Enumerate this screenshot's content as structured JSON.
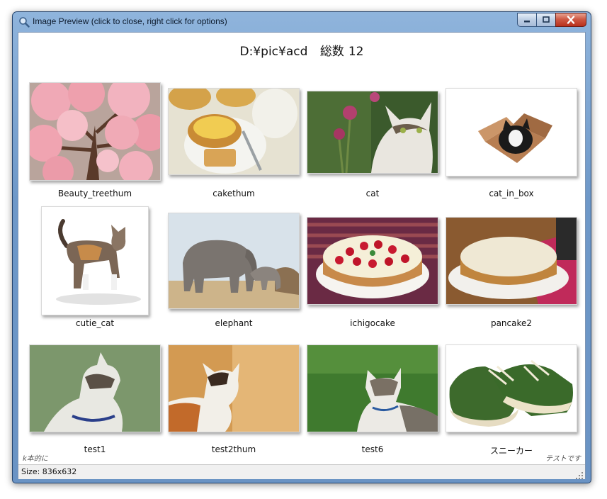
{
  "window": {
    "title": "Image Preview (click to close, right click for options)",
    "buttons": {
      "minimize": "minimize",
      "maximize": "maximize",
      "close": "close"
    }
  },
  "header": {
    "path": "D:¥pic¥acd",
    "count_label": "総数",
    "count": "12"
  },
  "thumbnails": [
    {
      "caption": "Beauty_treethum",
      "icon": "cherry-blossom-tree"
    },
    {
      "caption": "cakethum",
      "icon": "egg-tart-cake"
    },
    {
      "caption": "cat",
      "icon": "cat-looking-up"
    },
    {
      "caption": "cat_in_box",
      "icon": "cat-in-box"
    },
    {
      "caption": "cutie_cat",
      "icon": "standing-calico-cat"
    },
    {
      "caption": "elephant",
      "icon": "elephants"
    },
    {
      "caption": "ichigocake",
      "icon": "strawberry-cake"
    },
    {
      "caption": "pancake2",
      "icon": "cheesecake"
    },
    {
      "caption": "test1",
      "icon": "kitten-profile"
    },
    {
      "caption": "test2thum",
      "icon": "calico-kitten"
    },
    {
      "caption": "test6",
      "icon": "kitten-on-grass"
    },
    {
      "caption": "スニーカー",
      "icon": "green-sneakers"
    }
  ],
  "footer": {
    "left": "k本的に",
    "right": "テストです"
  },
  "status": {
    "size": "Size: 836x632"
  },
  "colors": {
    "title_bar": "#6e98c8",
    "close_button": "#cf5a45",
    "status_bar": "#f0f0f0"
  }
}
